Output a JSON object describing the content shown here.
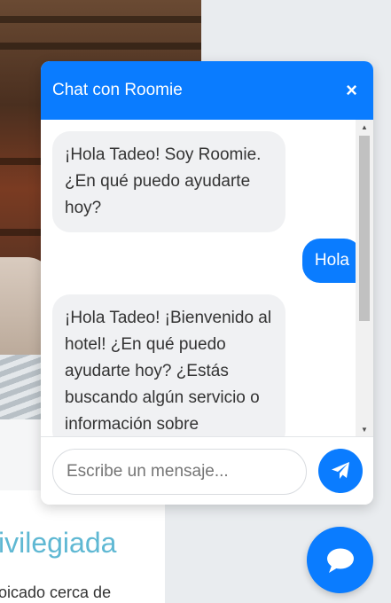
{
  "background": {
    "heading": "ivilegiada",
    "paragraph": "oicado cerca de"
  },
  "chat": {
    "title": "Chat con Roomie",
    "close_label": "×",
    "messages": [
      {
        "sender": "bot",
        "text": "¡Hola Tadeo! Soy Roomie. ¿En qué puedo ayudarte hoy?"
      },
      {
        "sender": "user",
        "text": "Hola"
      },
      {
        "sender": "bot",
        "text": "¡Hola Tadeo! ¡Bienvenido al hotel! ¿En qué puedo ayudarte hoy? ¿Estás buscando algún servicio o información sobre"
      }
    ],
    "input": {
      "value": "",
      "placeholder": "Escribe un mensaje..."
    },
    "send_icon": "paper-plane-icon"
  },
  "launcher": {
    "icon": "chat-bubble-icon"
  },
  "colors": {
    "accent": "#0a7cff",
    "bot_bubble": "#f0f1f3",
    "heading": "#5fb8d3"
  }
}
